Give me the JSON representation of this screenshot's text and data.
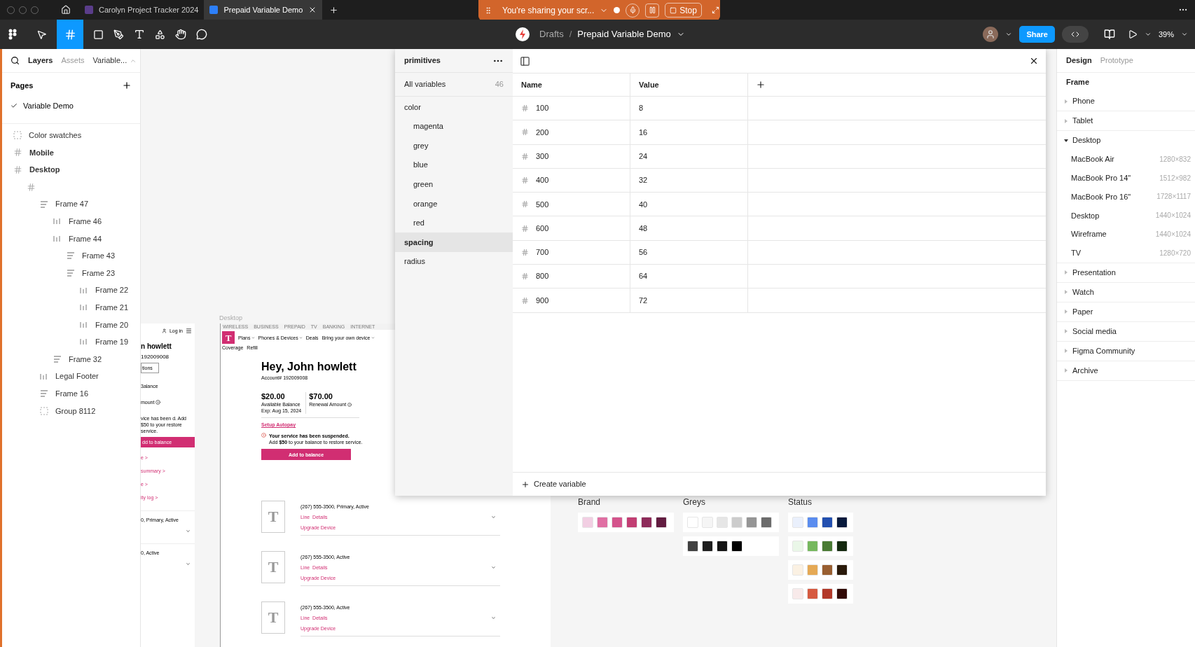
{
  "top_bar": {
    "tabs": [
      {
        "title": "Carolyn Project Tracker 2024",
        "selected": false
      },
      {
        "title": "Prepaid Variable Demo",
        "selected": true
      }
    ],
    "sharing": {
      "message": "You're sharing your scr...",
      "stop": "Stop"
    }
  },
  "toolbar": {
    "folder": "Drafts",
    "separator": "/",
    "file": "Prepaid Variable Demo",
    "share": "Share",
    "zoom": "39%"
  },
  "left_panel": {
    "tabs": [
      {
        "label": "Layers",
        "selected": true
      },
      {
        "label": "Assets",
        "selected": false
      }
    ],
    "page_menu": "Variable...",
    "pages_title": "Pages",
    "pages": [
      {
        "name": "Variable Demo",
        "selected": true
      }
    ],
    "layers": [
      {
        "name": "Color swatches",
        "kind": "group"
      },
      {
        "name": "Mobile",
        "kind": "frame"
      },
      {
        "name": "Desktop",
        "kind": "frame",
        "children": [
          {
            "kind": "frame",
            "children": [
              {
                "name": "Frame 47",
                "kind": "vstack",
                "children": [
                  {
                    "name": "Frame 46",
                    "kind": "hstack"
                  },
                  {
                    "name": "Frame 44",
                    "kind": "hstack",
                    "children": [
                      {
                        "name": "Frame 43",
                        "kind": "vstack"
                      },
                      {
                        "name": "Frame 23",
                        "kind": "vstack",
                        "children": [
                          {
                            "name": "Frame 22",
                            "kind": "hstack"
                          },
                          {
                            "name": "Frame 21",
                            "kind": "hstack"
                          },
                          {
                            "name": "Frame 20",
                            "kind": "hstack"
                          },
                          {
                            "name": "Frame 19",
                            "kind": "hstack"
                          }
                        ]
                      }
                    ]
                  },
                  {
                    "name": "Frame 32",
                    "kind": "vstack"
                  }
                ]
              },
              {
                "name": "Legal Footer",
                "kind": "hstack"
              },
              {
                "name": "Frame 16",
                "kind": "vstack"
              },
              {
                "name": "Group 8112",
                "kind": "group"
              }
            ]
          }
        ]
      }
    ]
  },
  "canvas": {
    "mobile_frame": {
      "login": "Log in",
      "name": "n howlett",
      "account": "192009008",
      "button": "tions",
      "balance_label": "3alance",
      "renewal_label": "mount",
      "notice": "vice has been d. Add $50 to your restore service.",
      "add_button": "dd to balance",
      "links": [
        "e >",
        "summary >",
        "e >",
        "ity log >"
      ],
      "lines": [
        "0, Primary, Active",
        "0, Active"
      ]
    },
    "desktop_frame": {
      "label": "Desktop",
      "top_links": [
        "WIRELESS",
        "BUSINESS",
        "PREPAID",
        "TV",
        "BANKING",
        "INTERNET"
      ],
      "logo": "T",
      "nav": [
        {
          "label": "Plans",
          "dropdown": true
        },
        {
          "label": "Phones & Devices",
          "dropdown": true
        },
        {
          "label": "Deals",
          "dropdown": false
        },
        {
          "label": "Bring your own device",
          "dropdown": true
        },
        {
          "label": "Coverage",
          "dropdown": false
        },
        {
          "label": "Refill",
          "dropdown": false
        }
      ],
      "greeting": "Hey, John howlett",
      "account": "Account# 192009008",
      "balances": [
        {
          "amount": "$20.00",
          "label": "Available Balance",
          "note": "Exp: Aug 15, 2024"
        },
        {
          "amount": "$70.00",
          "label": "Renewal Amount"
        }
      ],
      "autopay": "Setup Autopay",
      "alert_title": "Your service has been suspended.",
      "alert_body": "Add **$50** to your balance to restore service.",
      "add_button": "Add to balance",
      "lines": [
        {
          "thumb": "T",
          "number": "(267) 555-3500, Primary, Active",
          "details": "Line  Details",
          "upgrade": "Upgrade Device"
        },
        {
          "thumb": "T",
          "number": "(267) 555-3500, Active",
          "details": "Line  Details",
          "upgrade": "Upgrade Device"
        },
        {
          "thumb": "T",
          "number": "(267) 555-3500, Active",
          "details": "Line  Details",
          "upgrade": "Upgrade Device"
        }
      ]
    },
    "swatch_groups": [
      {
        "title": "Brand",
        "rows": [
          [
            {
              "color": "#f2cfe3"
            },
            {
              "color": "#e06fa3"
            },
            {
              "color": "#d4548c"
            },
            {
              "color": "#c23e73"
            },
            {
              "color": "#8e2b5a"
            },
            {
              "color": "#621c40"
            }
          ]
        ]
      },
      {
        "title": "Greys",
        "rows": [
          [
            {
              "color": "#ffffff"
            },
            {
              "color": "#f5f5f5"
            },
            {
              "color": "#e6e6e6"
            },
            {
              "color": "#cccccc"
            },
            {
              "color": "#959595"
            },
            {
              "color": "#6b6b6b"
            }
          ],
          [
            {
              "color": "#414141"
            },
            {
              "color": "#1e1e1e"
            },
            {
              "color": "#141414"
            },
            {
              "color": "#000000"
            }
          ]
        ]
      },
      {
        "title": "Status",
        "rows": [
          [
            {
              "color": "#eaf0fc"
            },
            {
              "color": "#5b8def"
            },
            {
              "color": "#2350b0"
            },
            {
              "color": "#081a3c"
            }
          ],
          [
            {
              "color": "#eaf7e8"
            },
            {
              "color": "#76b85e"
            },
            {
              "color": "#4a7b34"
            },
            {
              "color": "#14290f"
            }
          ],
          [
            {
              "color": "#fbf1e3"
            },
            {
              "color": "#e5a955"
            },
            {
              "color": "#995f31"
            },
            {
              "color": "#2a1a0b"
            }
          ],
          [
            {
              "color": "#f8eaea"
            },
            {
              "color": "#d65a40"
            },
            {
              "color": "#b2392a"
            },
            {
              "color": "#320b07"
            }
          ]
        ]
      }
    ]
  },
  "variables": {
    "collection": "primitives",
    "all_label": "All variables",
    "count": "46",
    "groups": [
      {
        "name": "color",
        "selected": false,
        "children": [
          {
            "name": "magenta",
            "selected": false
          },
          {
            "name": "grey",
            "selected": false
          },
          {
            "name": "blue",
            "selected": false
          },
          {
            "name": "green",
            "selected": false
          },
          {
            "name": "orange",
            "selected": false
          },
          {
            "name": "red",
            "selected": false
          }
        ]
      },
      {
        "name": "spacing",
        "selected": true
      },
      {
        "name": "radius",
        "selected": false
      }
    ],
    "columns": [
      "Name",
      "Value"
    ],
    "rows": [
      {
        "name": "100",
        "value": "8"
      },
      {
        "name": "200",
        "value": "16"
      },
      {
        "name": "300",
        "value": "24"
      },
      {
        "name": "400",
        "value": "32"
      },
      {
        "name": "500",
        "value": "40"
      },
      {
        "name": "600",
        "value": "48"
      },
      {
        "name": "700",
        "value": "56"
      },
      {
        "name": "800",
        "value": "64"
      },
      {
        "name": "900",
        "value": "72"
      }
    ],
    "create": "Create variable"
  },
  "design_panel": {
    "tabs": [
      {
        "label": "Design",
        "selected": true
      },
      {
        "label": "Prototype",
        "selected": false
      }
    ],
    "section": "Frame",
    "categories": [
      {
        "name": "Phone",
        "expanded": false
      },
      {
        "name": "Tablet",
        "expanded": false
      },
      {
        "name": "Desktop",
        "expanded": true,
        "presets": [
          {
            "name": "MacBook Air",
            "size": "1280×832"
          },
          {
            "name": "MacBook Pro 14\"",
            "size": "1512×982"
          },
          {
            "name": "MacBook Pro 16\"",
            "size": "1728×1117"
          },
          {
            "name": "Desktop",
            "size": "1440×1024"
          },
          {
            "name": "Wireframe",
            "size": "1440×1024"
          },
          {
            "name": "TV",
            "size": "1280×720"
          }
        ]
      },
      {
        "name": "Presentation",
        "expanded": false
      },
      {
        "name": "Watch",
        "expanded": false
      },
      {
        "name": "Paper",
        "expanded": false
      },
      {
        "name": "Social media",
        "expanded": false
      },
      {
        "name": "Figma Community",
        "expanded": false
      },
      {
        "name": "Archive",
        "expanded": false
      }
    ]
  }
}
